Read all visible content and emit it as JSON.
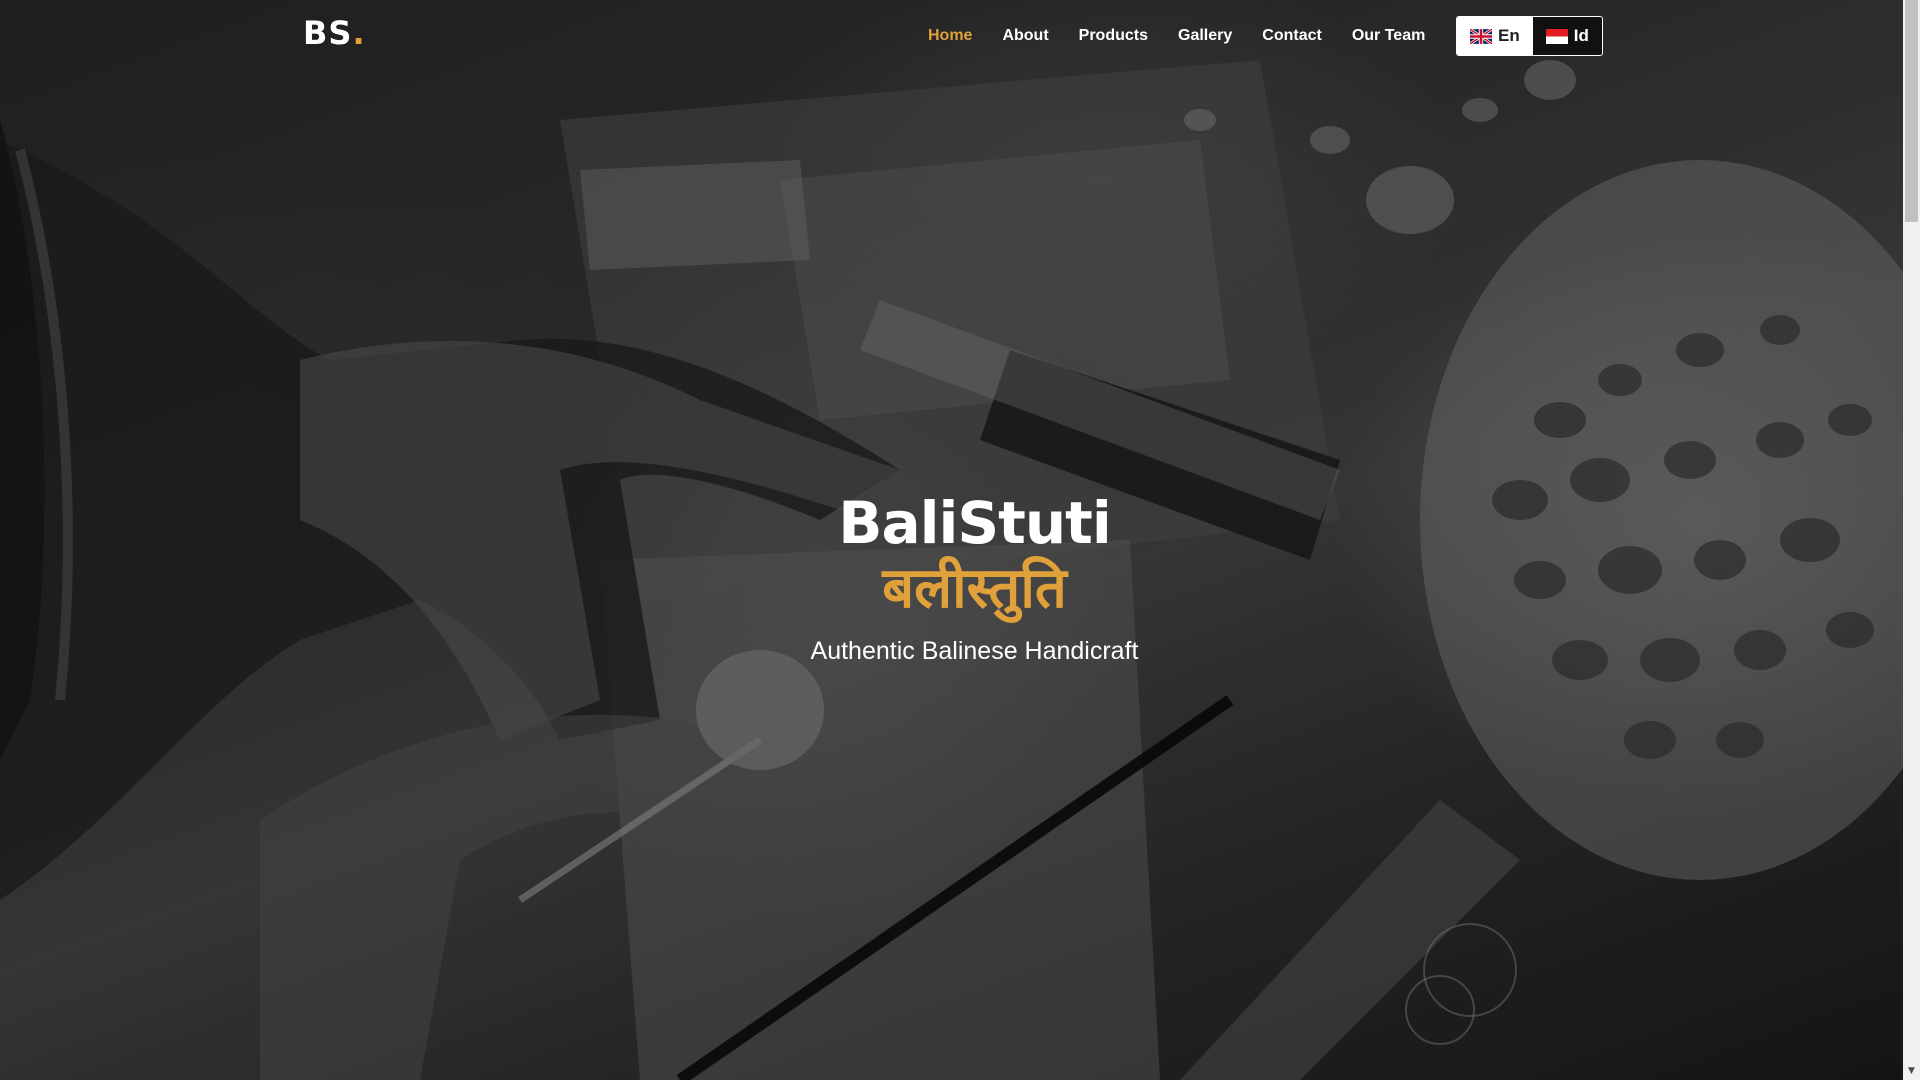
{
  "header": {
    "logo_text": "BS",
    "logo_dot": ".",
    "nav": [
      {
        "label": "Home",
        "active": true
      },
      {
        "label": "About",
        "active": false
      },
      {
        "label": "Products",
        "active": false
      },
      {
        "label": "Gallery",
        "active": false
      },
      {
        "label": "Contact",
        "active": false
      },
      {
        "label": "Our Team",
        "active": false
      }
    ],
    "languages": [
      {
        "label": "En",
        "icon": "uk-flag-icon"
      },
      {
        "label": "Id",
        "icon": "indonesia-flag-icon"
      }
    ]
  },
  "hero": {
    "title": "BaliStuti",
    "title_script": "बलीस्तुति",
    "tagline": "Authentic Balinese Handicraft",
    "background": "workshop-photo"
  },
  "colors": {
    "accent": "#e0a03a",
    "text": "#ffffff",
    "lang_active_bg": "#ffffff",
    "lang_inactive_bg": "#111111"
  }
}
